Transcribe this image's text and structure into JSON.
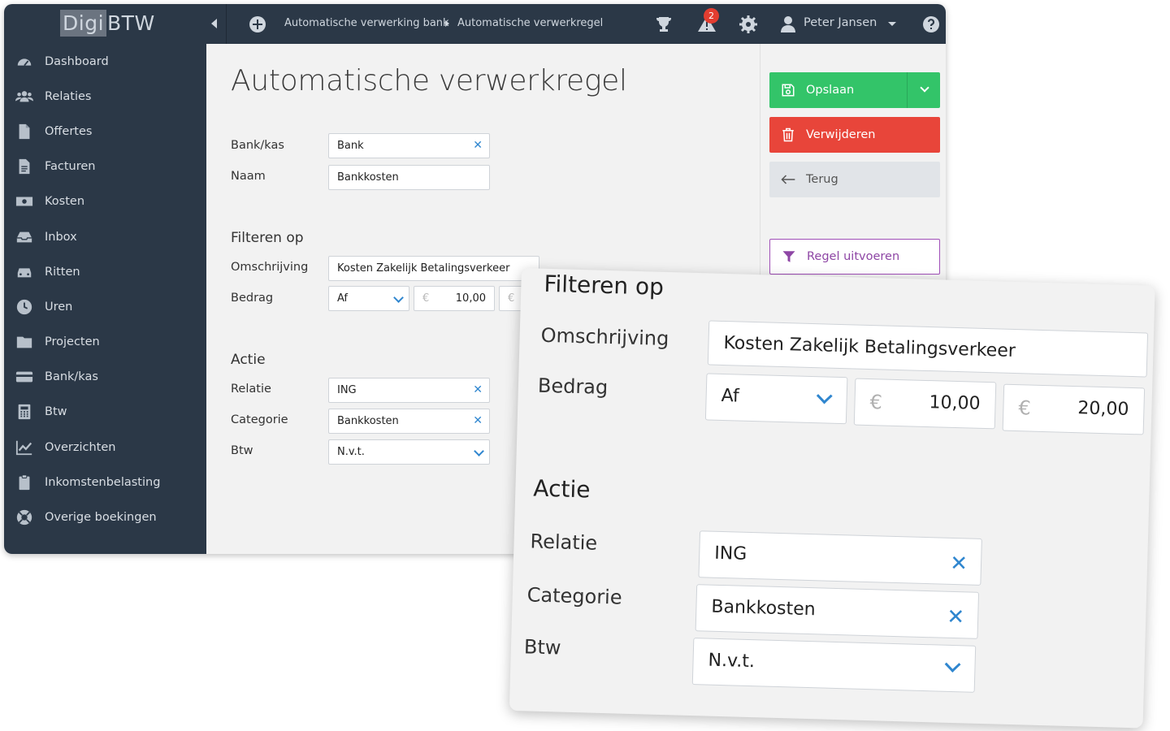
{
  "app": {
    "logo_a": "Digi",
    "logo_b": "BTW"
  },
  "sidebar": {
    "items": [
      {
        "label": "Dashboard",
        "icon": "dashboard-icon"
      },
      {
        "label": "Relaties",
        "icon": "users-icon"
      },
      {
        "label": "Offertes",
        "icon": "file-icon"
      },
      {
        "label": "Facturen",
        "icon": "invoice-icon"
      },
      {
        "label": "Kosten",
        "icon": "money-icon"
      },
      {
        "label": "Inbox",
        "icon": "inbox-icon"
      },
      {
        "label": "Ritten",
        "icon": "car-icon"
      },
      {
        "label": "Uren",
        "icon": "clock-icon"
      },
      {
        "label": "Projecten",
        "icon": "folder-icon"
      },
      {
        "label": "Bank/kas",
        "icon": "credit-card-icon"
      },
      {
        "label": "Btw",
        "icon": "calculator-icon"
      },
      {
        "label": "Overzichten",
        "icon": "chart-icon"
      },
      {
        "label": "Inkomstenbelasting",
        "icon": "clipboard-icon"
      },
      {
        "label": "Overige boekingen",
        "icon": "lifebuoy-icon"
      }
    ]
  },
  "topbar": {
    "breadcrumb": [
      "Automatische verwerking bank",
      "Automatische verwerkregel"
    ],
    "notification_count": "2",
    "user_name": "Peter Jansen"
  },
  "form": {
    "title": "Automatische verwerkregel",
    "bank_label": "Bank/kas",
    "bank_value": "Bank",
    "name_label": "Naam",
    "name_value": "Bankkosten",
    "filter_section": "Filteren op",
    "description_label": "Omschrijving",
    "description_value": "Kosten Zakelijk Betalingsverkeer",
    "amount_label": "Bedrag",
    "amount_direction": "Af",
    "currency": "€",
    "amount_min": "10,00",
    "amount_max": "20,00",
    "action_section": "Actie",
    "relation_label": "Relatie",
    "relation_value": "ING",
    "category_label": "Categorie",
    "category_value": "Bankkosten",
    "vat_label": "Btw",
    "vat_value": "N.v.t."
  },
  "actions": {
    "save": "Opslaan",
    "delete": "Verwijderen",
    "back": "Terug",
    "run_rule": "Regel uitvoeren"
  },
  "colors": {
    "sidebar": "#2b3847",
    "save": "#33c469",
    "delete": "#e8453a",
    "accent": "#2f86cf",
    "run": "#8e46a5"
  }
}
